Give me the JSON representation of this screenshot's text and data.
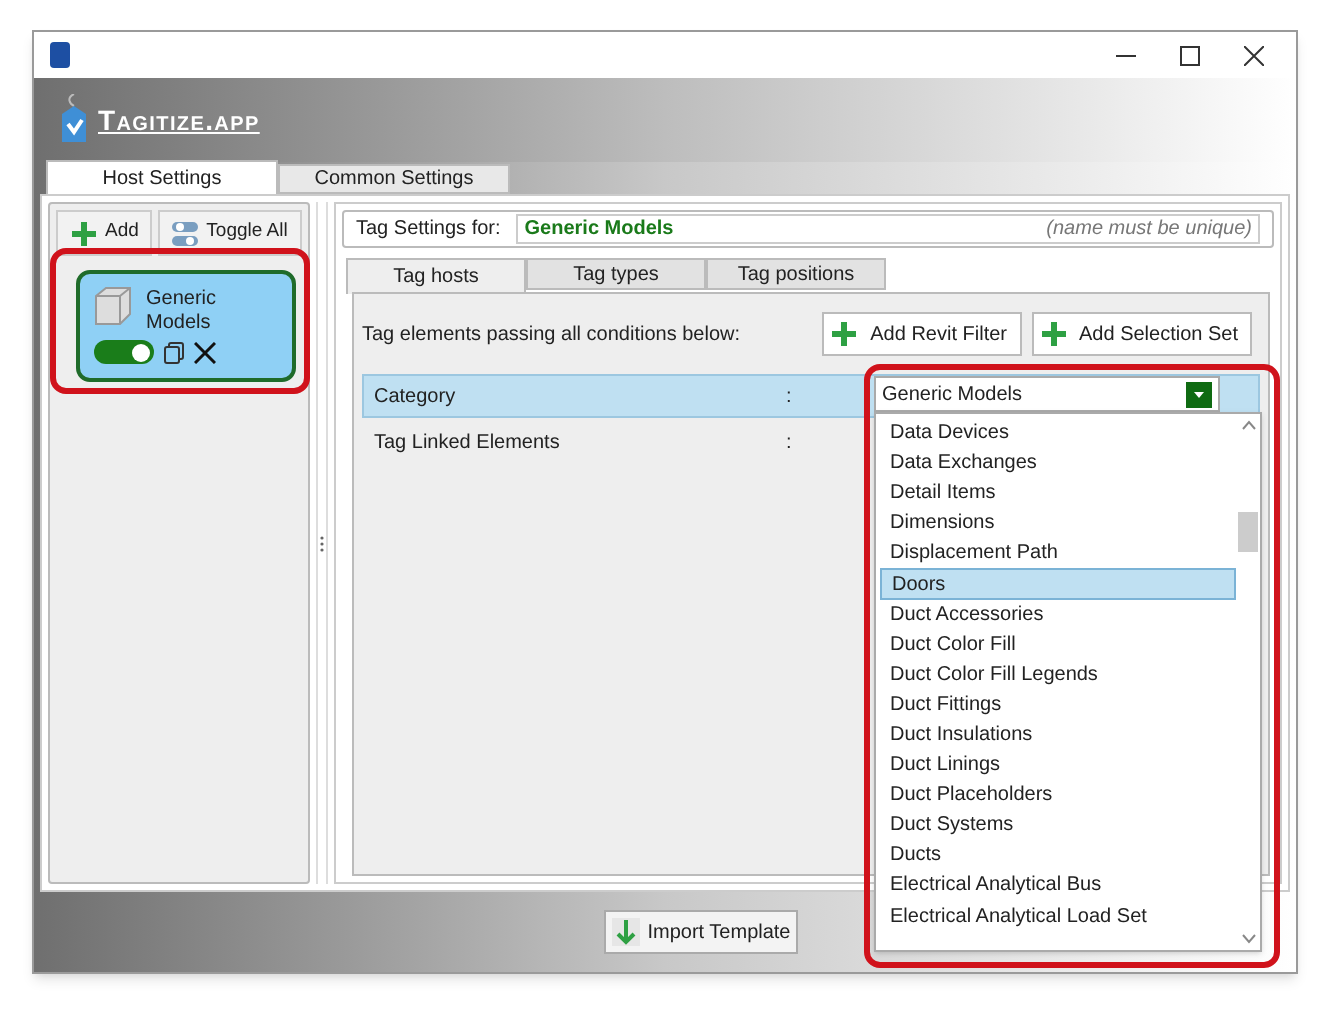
{
  "window": {
    "app_name": "Tagitize.app"
  },
  "main_tabs": [
    {
      "label": "Host Settings",
      "selected": true
    },
    {
      "label": "Common Settings",
      "selected": false
    }
  ],
  "sidebar": {
    "buttons": [
      {
        "label": "Add",
        "kind": "add"
      },
      {
        "label": "Toggle All",
        "kind": "toggle"
      }
    ],
    "items": [
      {
        "label": "Generic Models",
        "on": true,
        "selected": true
      }
    ]
  },
  "tag_settings": {
    "label": "Tag Settings for:",
    "value": "Generic Models",
    "hint": "(name must be unique)"
  },
  "inner_tabs": [
    {
      "label": "Tag hosts",
      "selected": true
    },
    {
      "label": "Tag types",
      "selected": false
    },
    {
      "label": "Tag positions",
      "selected": false
    }
  ],
  "conditions": {
    "caption": "Tag elements passing all conditions below:",
    "buttons": [
      "Add Revit Filter",
      "Add Selection Set"
    ],
    "rows": [
      {
        "label": "Category",
        "separator": ":",
        "selected": true
      },
      {
        "label": "Tag Linked Elements",
        "separator": ":",
        "selected": false
      }
    ]
  },
  "category_dropdown": {
    "value": "Generic Models",
    "options": [
      {
        "label": "Data Devices",
        "selected": false
      },
      {
        "label": "Data Exchanges",
        "selected": false
      },
      {
        "label": "Detail Items",
        "selected": false
      },
      {
        "label": "Dimensions",
        "selected": false
      },
      {
        "label": "Displacement Path",
        "selected": false
      },
      {
        "label": "Doors",
        "selected": true
      },
      {
        "label": "Duct Accessories",
        "selected": false
      },
      {
        "label": "Duct Color Fill",
        "selected": false
      },
      {
        "label": "Duct Color Fill Legends",
        "selected": false
      },
      {
        "label": "Duct Fittings",
        "selected": false
      },
      {
        "label": "Duct Insulations",
        "selected": false
      },
      {
        "label": "Duct Linings",
        "selected": false
      },
      {
        "label": "Duct Placeholders",
        "selected": false
      },
      {
        "label": "Duct Systems",
        "selected": false
      },
      {
        "label": "Ducts",
        "selected": false
      },
      {
        "label": "Electrical Analytical Bus",
        "selected": false
      },
      {
        "label": "Electrical Analytical Load Set",
        "selected": false
      }
    ]
  },
  "footer": {
    "import_button": "Import Template"
  }
}
